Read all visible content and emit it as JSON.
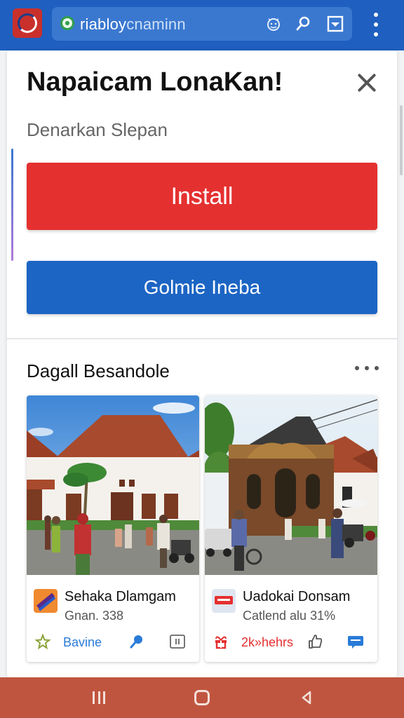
{
  "browser": {
    "url_text": "riabloy",
    "url_suffix": "cnaminn",
    "icons": [
      "app-icon",
      "secure-icon",
      "emoji-icon",
      "search-icon",
      "download-icon",
      "menu-icon"
    ]
  },
  "dialog": {
    "title": "Napaicam LonaKan!",
    "subtitle": "Denarkan Slepan",
    "install_label": "Install",
    "secondary_label": "Golmie Ineba"
  },
  "section": {
    "title": "Dagall Besandole"
  },
  "apps": [
    {
      "name": "Sehaka Dlamgam",
      "meta": "Gnan. 338",
      "action_label": "Bavine",
      "action_color": "#2a7bd8",
      "icons": [
        "app-thumb-icon",
        "star-icon",
        "search-icon",
        "download-icon"
      ]
    },
    {
      "name": "Uadokai Donsam",
      "meta": "Catlend alu 31%",
      "action_label": "2k»hehrs",
      "action_color": "#e53030",
      "icons": [
        "app-thumb-icon",
        "gift-icon",
        "like-icon",
        "message-icon"
      ]
    }
  ],
  "colors": {
    "brand_blue": "#1f5fbf",
    "install_red": "#e53030",
    "secondary_blue": "#1c65c4",
    "nav_bar": "#c0553f"
  }
}
